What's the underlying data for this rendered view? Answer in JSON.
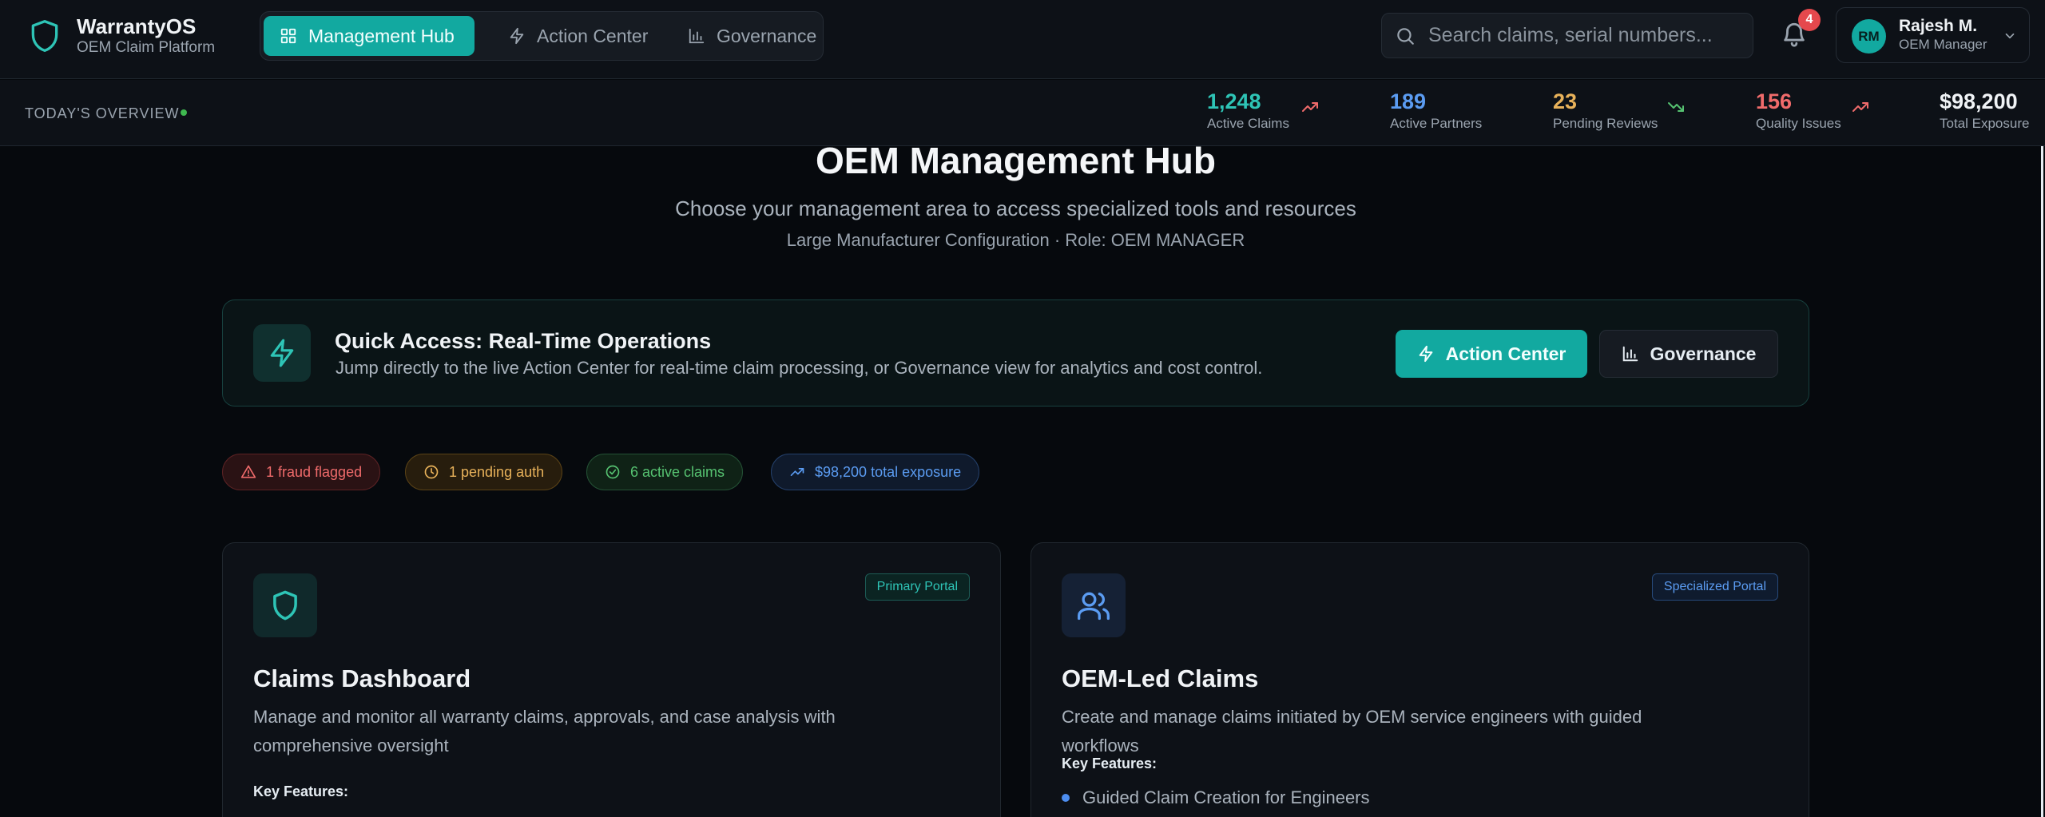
{
  "app": {
    "name": "WarrantyOS",
    "subtitle": "OEM Claim Platform"
  },
  "nav": {
    "items": [
      {
        "label": "Management Hub",
        "icon": "grid-icon",
        "active": true
      },
      {
        "label": "Action Center",
        "icon": "bolt-icon",
        "active": false
      },
      {
        "label": "Governance",
        "icon": "bar-chart-icon",
        "active": false
      }
    ]
  },
  "search": {
    "placeholder": "Search claims, serial numbers..."
  },
  "notifications": {
    "count": "4"
  },
  "user": {
    "initials": "RM",
    "name": "Rajesh M.",
    "role": "OEM Manager"
  },
  "overview": {
    "label": "TODAY'S OVERVIEW",
    "stats": [
      {
        "value": "1,248",
        "label": "Active Claims",
        "color": "#2ec4b6",
        "trend": "up"
      },
      {
        "value": "189",
        "label": "Active Partners",
        "color": "#5b9cf2",
        "trend": "none"
      },
      {
        "value": "23",
        "label": "Pending Reviews",
        "color": "#e8b25a",
        "trend": "down"
      },
      {
        "value": "156",
        "label": "Quality Issues",
        "color": "#f06b6b",
        "trend": "up"
      },
      {
        "value": "$98,200",
        "label": "Total Exposure",
        "color": "#f0f3f6",
        "trend": "none"
      }
    ]
  },
  "hero": {
    "title": "OEM Management Hub",
    "subtitle": "Choose your management area to access specialized tools and resources",
    "config": "Large Manufacturer Configuration · Role: OEM MANAGER"
  },
  "quick_access": {
    "title": "Quick Access: Real-Time Operations",
    "description": "Jump directly to the live Action Center for real-time claim processing, or Governance view for analytics and cost control.",
    "action_button": "Action Center",
    "governance_button": "Governance"
  },
  "pills": [
    {
      "label": "1 fraud flagged",
      "icon": "alert-triangle-icon"
    },
    {
      "label": "1 pending auth",
      "icon": "clock-icon"
    },
    {
      "label": "6 active claims",
      "icon": "check-circle-icon"
    },
    {
      "label": "$98,200 total exposure",
      "icon": "trending-up-icon"
    }
  ],
  "cards": [
    {
      "badge": "Primary Portal",
      "icon": "shield-icon",
      "title": "Claims Dashboard",
      "description": "Manage and monitor all warranty claims, approvals, and case analysis with comprehensive oversight",
      "key_features_label": "Key Features:",
      "features": []
    },
    {
      "badge": "Specialized Portal",
      "icon": "users-icon",
      "title": "OEM-Led Claims",
      "description": "Create and manage claims initiated by OEM service engineers with guided workflows",
      "key_features_label": "Key Features:",
      "features": [
        "Guided Claim Creation for Engineers"
      ]
    }
  ],
  "colors": {
    "accent": "#12a9a0",
    "danger": "#e5484d",
    "warning": "#e8b25a",
    "success": "#56c271",
    "info": "#5b9cf2"
  }
}
